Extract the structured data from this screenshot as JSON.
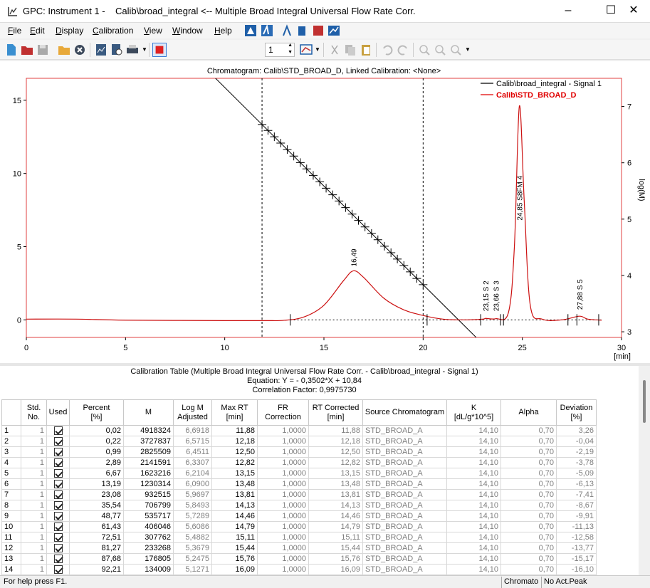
{
  "window": {
    "title": "GPC: Instrument 1 -    Calib\\broad_integral <-- Multiple Broad Integral Universal Flow Rate Corr.",
    "controls": [
      "–",
      "☐",
      "✕"
    ]
  },
  "menu": [
    {
      "u": "F",
      "rest": "ile"
    },
    {
      "u": "E",
      "rest": "dit"
    },
    {
      "u": "D",
      "rest": "isplay"
    },
    {
      "u": "C",
      "rest": "alibration"
    },
    {
      "u": "V",
      "rest": "iew"
    },
    {
      "u": "W",
      "rest": "indow"
    },
    {
      "u": "H",
      "rest": "elp"
    }
  ],
  "toolbar": {
    "spin_value": "1",
    "icons": [
      "new-icon",
      "open-icon",
      "save-icon",
      "folder-icon",
      "close-circle-icon",
      "report-icon",
      "print-preview-icon",
      "print-icon",
      "stop-icon",
      "peak-icon-1",
      "peak-icon-2",
      "peak-icon-3",
      "peak-icon-4",
      "peak-icon-5",
      "add-peak-icon",
      "chart-view-icon",
      "cut-icon",
      "copy-icon",
      "paste-icon",
      "undo-icon",
      "redo-icon",
      "zoom-in-icon",
      "zoom-out-icon",
      "zoom-reset-icon"
    ]
  },
  "chart_data": {
    "type": "line",
    "title": "Chromatogram: Calib\\STD_BROAD_D, Linked Calibration: <None>",
    "xlabel": "[min]",
    "ylabel_left": "",
    "ylabel_right": "log(M)",
    "xlim": [
      0,
      30
    ],
    "ylim_left": [
      -1.2,
      16.5
    ],
    "ylim_right": [
      2.9,
      7.5
    ],
    "x_ticks": [
      "0",
      "5",
      "10",
      "15",
      "20",
      "25",
      "30"
    ],
    "y_ticks_left": [
      "0",
      "5",
      "10",
      "15"
    ],
    "y_ticks_right": [
      "3",
      "4",
      "5",
      "6",
      "7"
    ],
    "legend": [
      {
        "name": "Calib\\broad_integral - Signal 1",
        "color": "#000000"
      },
      {
        "name": "Calib\\STD_BROAD_D",
        "color": "#e00000"
      }
    ],
    "integration_limits_min": [
      11.88,
      20.0
    ],
    "calibration_line": {
      "slope": -0.3502,
      "intercept": 10.84
    },
    "calibration_points_rt": [
      11.88,
      12.18,
      12.5,
      12.82,
      13.15,
      13.48,
      13.81,
      14.13,
      14.46,
      14.79,
      15.11,
      15.44,
      15.76,
      16.09,
      16.42,
      16.74,
      17.07,
      17.4,
      17.72,
      18.05,
      18.38,
      18.7,
      19.03,
      19.35,
      19.68,
      20.0
    ],
    "signal_series": [
      {
        "x": 0,
        "y": 0.05
      },
      {
        "x": 2.5,
        "y": 0.05
      },
      {
        "x": 5,
        "y": -0.02
      },
      {
        "x": 10,
        "y": -0.05
      },
      {
        "x": 12,
        "y": -0.05
      },
      {
        "x": 13,
        "y": -0.03
      },
      {
        "x": 14,
        "y": 0.2
      },
      {
        "x": 15,
        "y": 1.0
      },
      {
        "x": 16,
        "y": 2.7
      },
      {
        "x": 16.49,
        "y": 3.35
      },
      {
        "x": 17,
        "y": 2.9
      },
      {
        "x": 18,
        "y": 1.5
      },
      {
        "x": 19,
        "y": 0.7
      },
      {
        "x": 20,
        "y": 0.3
      },
      {
        "x": 21,
        "y": 0.05
      },
      {
        "x": 22,
        "y": 0.0
      },
      {
        "x": 23,
        "y": 0.05
      },
      {
        "x": 23.15,
        "y": 0.1
      },
      {
        "x": 23.66,
        "y": 0.08
      },
      {
        "x": 24.3,
        "y": 0.5
      },
      {
        "x": 24.6,
        "y": 5.0
      },
      {
        "x": 24.85,
        "y": 14.6
      },
      {
        "x": 25.1,
        "y": 8.0
      },
      {
        "x": 25.4,
        "y": 1.0
      },
      {
        "x": 26,
        "y": 0.05
      },
      {
        "x": 27,
        "y": 0.0
      },
      {
        "x": 27.88,
        "y": 0.25
      },
      {
        "x": 28.3,
        "y": 0.05
      },
      {
        "x": 29,
        "y": -0.02
      }
    ],
    "baseline": [
      {
        "x": 13.3,
        "y": 0
      },
      {
        "x": 29,
        "y": 0
      }
    ],
    "peak_labels": [
      {
        "x": 16.49,
        "y": 3.35,
        "text": "16,49"
      },
      {
        "x": 23.15,
        "y": 0.3,
        "text": "23,15  S 2"
      },
      {
        "x": 23.66,
        "y": 0.3,
        "text": "23,66  S 3"
      },
      {
        "x": 24.85,
        "y": 6.5,
        "text": "24,85  S8FM 4"
      },
      {
        "x": 27.88,
        "y": 0.4,
        "text": "27,88  S 5"
      }
    ],
    "peak_markers_x": [
      13.3,
      20.2,
      22.9,
      23.9,
      24.05,
      27.3,
      27.75,
      28.85
    ]
  },
  "calibration_table": {
    "title": "Calibration Table (Multiple Broad Integral Universal Flow Rate Corr. - Calib\\broad_integral - Signal 1)",
    "equation": "Equation: Y =  - 0,3502*X + 10,84",
    "correlation": "Correlation Factor: 0,9975730",
    "columns": [
      "",
      "Std.\nNo.",
      "Used",
      "Percent\n[%]",
      "M",
      "Log M\nAdjusted",
      "Max RT\n[min]",
      "FR Correction",
      "RT Corrected\n[min]",
      "Source Chromatogram",
      "K\n[dL/g*10^5]",
      "Alpha",
      "Deviation\n[%]"
    ],
    "rows": [
      [
        "1",
        "1",
        "0,02",
        "4918324",
        "6,6918",
        "11,88",
        "1,0000",
        "11,88",
        "STD_BROAD_A",
        "14,10",
        "0,70",
        "3,26"
      ],
      [
        "2",
        "1",
        "0,22",
        "3727837",
        "6,5715",
        "12,18",
        "1,0000",
        "12,18",
        "STD_BROAD_A",
        "14,10",
        "0,70",
        "-0,04"
      ],
      [
        "3",
        "1",
        "0,99",
        "2825509",
        "6,4511",
        "12,50",
        "1,0000",
        "12,50",
        "STD_BROAD_A",
        "14,10",
        "0,70",
        "-2,19"
      ],
      [
        "4",
        "1",
        "2,89",
        "2141591",
        "6,3307",
        "12,82",
        "1,0000",
        "12,82",
        "STD_BROAD_A",
        "14,10",
        "0,70",
        "-3,78"
      ],
      [
        "5",
        "1",
        "6,67",
        "1623216",
        "6,2104",
        "13,15",
        "1,0000",
        "13,15",
        "STD_BROAD_A",
        "14,10",
        "0,70",
        "-5,09"
      ],
      [
        "6",
        "1",
        "13,19",
        "1230314",
        "6,0900",
        "13,48",
        "1,0000",
        "13,48",
        "STD_BROAD_A",
        "14,10",
        "0,70",
        "-6,13"
      ],
      [
        "7",
        "1",
        "23,08",
        "932515",
        "5,9697",
        "13,81",
        "1,0000",
        "13,81",
        "STD_BROAD_A",
        "14,10",
        "0,70",
        "-7,41"
      ],
      [
        "8",
        "1",
        "35,54",
        "706799",
        "5,8493",
        "14,13",
        "1,0000",
        "14,13",
        "STD_BROAD_A",
        "14,10",
        "0,70",
        "-8,67"
      ],
      [
        "9",
        "1",
        "48,77",
        "535717",
        "5,7289",
        "14,46",
        "1,0000",
        "14,46",
        "STD_BROAD_A",
        "14,10",
        "0,70",
        "-9,91"
      ],
      [
        "10",
        "1",
        "61,43",
        "406046",
        "5,6086",
        "14,79",
        "1,0000",
        "14,79",
        "STD_BROAD_A",
        "14,10",
        "0,70",
        "-11,13"
      ],
      [
        "11",
        "1",
        "72,51",
        "307762",
        "5,4882",
        "15,11",
        "1,0000",
        "15,11",
        "STD_BROAD_A",
        "14,10",
        "0,70",
        "-12,58"
      ],
      [
        "12",
        "1",
        "81,27",
        "233268",
        "5,3679",
        "15,44",
        "1,0000",
        "15,44",
        "STD_BROAD_A",
        "14,10",
        "0,70",
        "-13,77"
      ],
      [
        "13",
        "1",
        "87,68",
        "176805",
        "5,2475",
        "15,76",
        "1,0000",
        "15,76",
        "STD_BROAD_A",
        "14,10",
        "0,70",
        "-15,17"
      ],
      [
        "14",
        "1",
        "92,21",
        "134009",
        "5,1271",
        "16,09",
        "1,0000",
        "16,09",
        "STD_BROAD_A",
        "14,10",
        "0,70",
        "-16,10"
      ]
    ]
  },
  "statusbar": {
    "help": "For help press F1.",
    "pane1": "Chromato",
    "pane2": "No Act.Peak"
  }
}
